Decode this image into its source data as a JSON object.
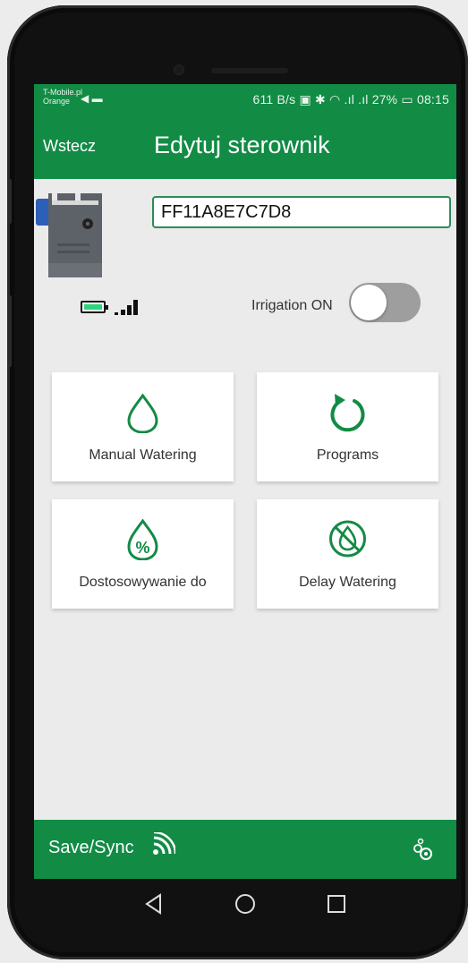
{
  "status_bar": {
    "carrier_line1": "T-Mobile.pl",
    "carrier_line2": "Orange",
    "data_rate": "611 B/s",
    "battery": "27%",
    "time": "08:15"
  },
  "app_bar": {
    "back_label": "Wstecz",
    "title": "Edytuj sterownik"
  },
  "controller": {
    "id_value": "FF11A8E7C7D8",
    "irrigation_label": "Irrigation ON",
    "irrigation_on": false
  },
  "tiles": [
    {
      "label": "Manual Watering",
      "icon": "water-drop-icon"
    },
    {
      "label": "Programs",
      "icon": "refresh-icon"
    },
    {
      "label": "Dostosowywanie do",
      "icon": "percent-drop-icon"
    },
    {
      "label": "Delay Watering",
      "icon": "no-water-icon"
    }
  ],
  "bottom_bar": {
    "save_label": "Save/Sync",
    "sync_icon": "wireless-sync-icon",
    "settings_icon": "gears-icon"
  },
  "colors": {
    "primary": "#128b45",
    "battery_fill": "#2fd37e",
    "toggle_off": "#9e9e9e"
  }
}
